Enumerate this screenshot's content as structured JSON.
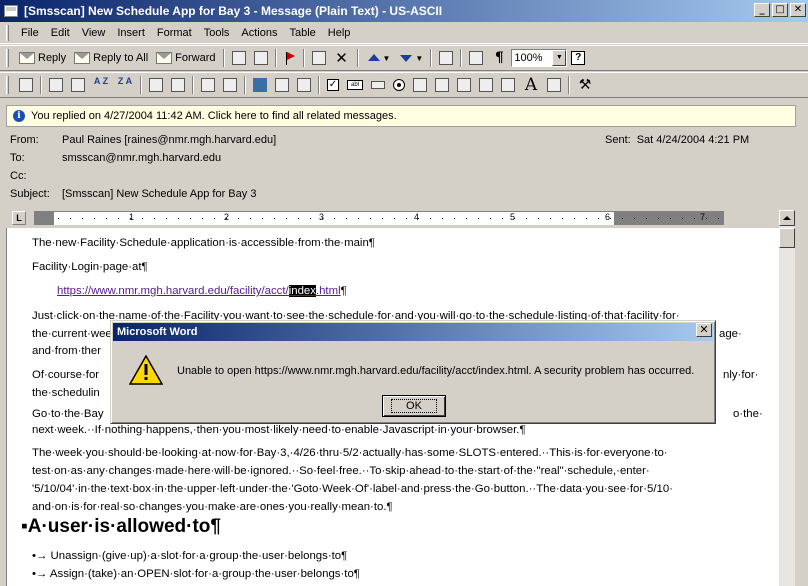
{
  "window": {
    "title": "[Smsscan] New Schedule App for Bay 3 - Message (Plain Text)  - US-ASCII",
    "min_glyph": "_",
    "max_glyph": "□",
    "close_glyph": "✕"
  },
  "menu": [
    "File",
    "Edit",
    "View",
    "Insert",
    "Format",
    "Tools",
    "Actions",
    "Table",
    "Help"
  ],
  "toolbar1": {
    "reply": "Reply",
    "reply_all": "Reply to All",
    "forward": "Forward",
    "zoom": "100%",
    "pilcrow": "¶",
    "help": "?"
  },
  "toolbar2": {
    "sort_az": "A Z",
    "sort_za": "Z A",
    "font_a": "A",
    "check": "✓",
    "field": "abl",
    "hammer": "⚒"
  },
  "infobar": {
    "icon": "i",
    "text": "You replied on 4/27/2004 11:42 AM. Click here to find all related messages."
  },
  "headers": {
    "from_label": "From:",
    "from": "Paul Raines [raines@nmr.mgh.harvard.edu]",
    "to_label": "To:",
    "to": "smsscan@nmr.mgh.harvard.edu",
    "cc_label": "Cc:",
    "cc": "",
    "subject_label": "Subject:",
    "subject": "[Smsscan] New Schedule App for Bay 3",
    "sent_label": "Sent:",
    "sent": "Sat 4/24/2004 4:21 PM"
  },
  "ruler": {
    "tab_selector": "L",
    "numbers": [
      "1",
      "2",
      "3",
      "4",
      "5",
      "6",
      "7"
    ]
  },
  "body": {
    "p1": "The·new·Facility·Schedule·application·is·accessible·from·the·main¶",
    "p2": "Facility·Login·page·at¶",
    "link_pre": "https://www.nmr.mgh.harvard.edu/facility/acct/",
    "link_sel": "index",
    "link_post": ".html",
    "link_end": "¶",
    "p4a": "Just·click·on·the·name·of·the·Facility·you·want·to·see·the·schedule·for·and·you·will·go·to·the·schedule·listing·of·that·facility·for·",
    "p4b": "the·current·week.",
    "p4b_right": "age·",
    "p4c": "and·from·ther",
    "p5a": "Of·course·for",
    "p5a_right": "nly·for·",
    "p5b": "the·schedulin",
    "p6a": "Go·to·the·Bay",
    "p6a_right": "o·the·",
    "p6b": "next·week.··If·nothing·happens,·then·you·most·likely·need·to·enable·Javascript·in·your·browser.¶",
    "p7a": "The·week·you·should·be·looking·at·now·for·Bay·3,·4/26·thru·5/2·actually·has·some·SLOTS·entered.··This·is·for·everyone·to·",
    "p7b": "test·on·as·any·changes·made·here·will·be·ignored.··So·feel·free.··To·skip·ahead·to·the·start·of·the·\"real\"·schedule,·enter·",
    "p7c": "'5/10/04'·in·the·text·box·in·the·upper·left·under·the·'Goto·Week·Of'·label·and·press·the·Go·button.··The·data·you·see·for·5/10·",
    "p7d": "and·on·is·for·real·so·changes·you·make·are·ones·you·really·mean·to.¶",
    "heading": "A·user·is·allowed·to¶",
    "b1": "•→ Unassign·(give·up)·a·slot·for·a·group·the·user·belongs·to¶",
    "b2": "•→ Assign·(take)·an·OPEN·slot·for·a·group·the·user·belongs·to¶"
  },
  "dialog": {
    "title": "Microsoft Word",
    "close": "✕",
    "message": "Unable to open https://www.nmr.mgh.harvard.edu/facility/acct/index.html. A security problem has occurred.",
    "ok": "OK"
  }
}
